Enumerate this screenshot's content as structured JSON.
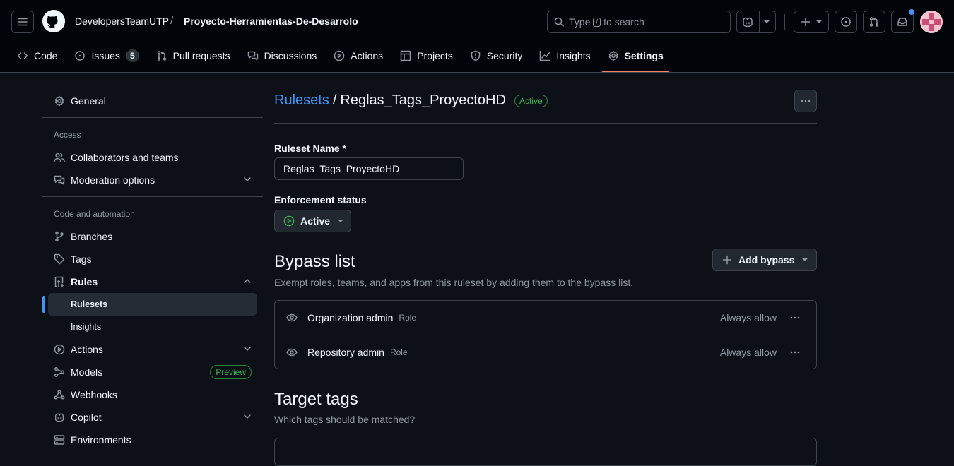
{
  "header": {
    "owner": "DevelopersTeamUTP",
    "separator": "/",
    "repo": "Proyecto-Herramientas-De-Desarrolo",
    "search": {
      "prefix": "Type",
      "key": "/",
      "suffix": "to search"
    }
  },
  "tabs": [
    {
      "label": "Code",
      "icon": "code-icon"
    },
    {
      "label": "Issues",
      "icon": "issue-opened-icon",
      "count": "5"
    },
    {
      "label": "Pull requests",
      "icon": "git-pull-request-icon"
    },
    {
      "label": "Discussions",
      "icon": "comment-discussion-icon"
    },
    {
      "label": "Actions",
      "icon": "play-icon"
    },
    {
      "label": "Projects",
      "icon": "table-icon"
    },
    {
      "label": "Security",
      "icon": "shield-icon"
    },
    {
      "label": "Insights",
      "icon": "graph-icon"
    },
    {
      "label": "Settings",
      "icon": "gear-icon",
      "selected": true
    }
  ],
  "sidebar": {
    "general": "General",
    "access_heading": "Access",
    "collaborators": "Collaborators and teams",
    "moderation": "Moderation options",
    "code_heading": "Code and automation",
    "branches": "Branches",
    "tags": "Tags",
    "rules": "Rules",
    "rulesets": "Rulesets",
    "insights": "Insights",
    "actions": "Actions",
    "models": "Models",
    "models_badge": "Preview",
    "webhooks": "Webhooks",
    "copilot": "Copilot",
    "environments": "Environments"
  },
  "main": {
    "breadcrumb_link": "Rulesets",
    "breadcrumb_sep": "/",
    "ruleset_title": "Reglas_Tags_ProyectoHD",
    "status_badge": "Active",
    "name_label": "Ruleset Name *",
    "name_value": "Reglas_Tags_ProyectoHD",
    "enforcement_label": "Enforcement status",
    "enforcement_value": "Active",
    "bypass_title": "Bypass list",
    "bypass_desc": "Exempt roles, teams, and apps from this ruleset by adding them to the bypass list.",
    "add_bypass": "Add bypass",
    "bypass_items": [
      {
        "name": "Organization admin",
        "type": "Role",
        "mode": "Always allow"
      },
      {
        "name": "Repository admin",
        "type": "Role",
        "mode": "Always allow"
      }
    ],
    "target_title": "Target tags",
    "target_desc": "Which tags should be matched?"
  },
  "colors": {
    "accent": "#4493f8",
    "success": "#3fb950",
    "selected_tab_underline": "#f78166",
    "background": "#0d1117",
    "header_background": "#010409"
  }
}
